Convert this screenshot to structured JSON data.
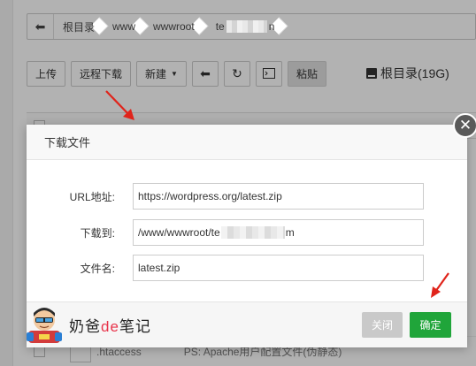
{
  "path": {
    "crumbs": [
      "根目录",
      "www",
      "wwwroot"
    ],
    "last_prefix": "te",
    "last_suffix": "n"
  },
  "toolbar": {
    "upload": "上传",
    "remote_download": "远程下载",
    "new": "新建",
    "paste": "粘贴",
    "disk_label": "根目录(19G)"
  },
  "bg_row": {
    "filename": ".htaccess",
    "description": "PS: Apache用户配置文件(伪静态)"
  },
  "dialog": {
    "title": "下载文件",
    "url_label": "URL地址:",
    "url_value": "https://wordpress.org/latest.zip",
    "dest_label": "下载到:",
    "dest_prefix": "/www/wwwroot/te",
    "dest_suffix": "m",
    "filename_label": "文件名:",
    "filename_value": "latest.zip",
    "cancel": "关闭",
    "confirm": "确定",
    "close_glyph": "✕"
  },
  "watermark": {
    "before": "奶爸",
    "accent": "de",
    "after": "笔记"
  },
  "colors": {
    "confirm": "#20a53a",
    "arrow": "#e0241b",
    "cancel": "#c9c9c9"
  }
}
